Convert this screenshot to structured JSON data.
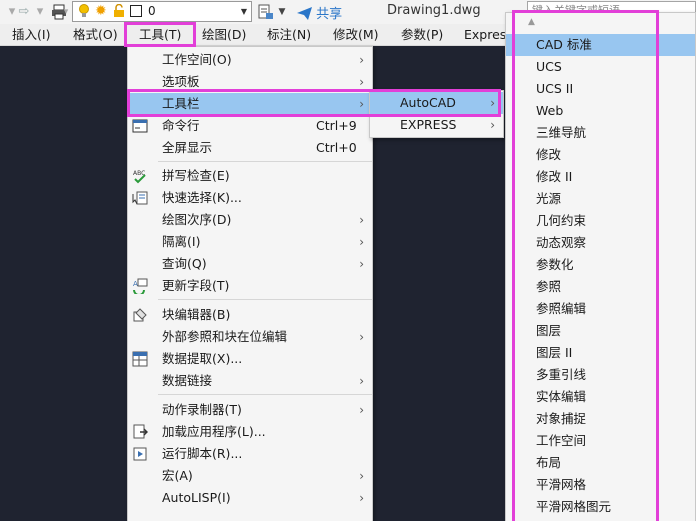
{
  "toolbar": {
    "layer_name": "0",
    "share_label": "共享",
    "document_title": "Drawing1.dwg",
    "search_placeholder": "键入关键字或短语"
  },
  "menubar": {
    "items": [
      "插入(I)",
      "格式(O)",
      "工具(T)",
      "绘图(D)",
      "标注(N)",
      "修改(M)",
      "参数(P)",
      "Expres"
    ],
    "active": "工具(T)"
  },
  "tools_menu": {
    "items": [
      {
        "label": "工作空间(O)",
        "shortcut": "",
        "submenu": true
      },
      {
        "label": "选项板",
        "shortcut": "",
        "submenu": true
      },
      {
        "label": "工具栏",
        "shortcut": "",
        "submenu": true,
        "highlighted": true
      },
      {
        "label": "命令行",
        "shortcut": "Ctrl+9",
        "submenu": false
      },
      {
        "label": "全屏显示",
        "shortcut": "Ctrl+0",
        "submenu": false
      },
      {
        "label": "拼写检查(E)",
        "shortcut": "",
        "submenu": false
      },
      {
        "label": "快速选择(K)...",
        "shortcut": "",
        "submenu": false
      },
      {
        "label": "绘图次序(D)",
        "shortcut": "",
        "submenu": true
      },
      {
        "label": "隔离(I)",
        "shortcut": "",
        "submenu": true
      },
      {
        "label": "查询(Q)",
        "shortcut": "",
        "submenu": true
      },
      {
        "label": "更新字段(T)",
        "shortcut": "",
        "submenu": false
      },
      {
        "label": "块编辑器(B)",
        "shortcut": "",
        "submenu": false
      },
      {
        "label": "外部参照和块在位编辑",
        "shortcut": "",
        "submenu": true
      },
      {
        "label": "数据提取(X)...",
        "shortcut": "",
        "submenu": false
      },
      {
        "label": "数据链接",
        "shortcut": "",
        "submenu": true
      },
      {
        "label": "动作录制器(T)",
        "shortcut": "",
        "submenu": true
      },
      {
        "label": "加载应用程序(L)...",
        "shortcut": "",
        "submenu": false
      },
      {
        "label": "运行脚本(R)...",
        "shortcut": "",
        "submenu": false
      },
      {
        "label": "宏(A)",
        "shortcut": "",
        "submenu": true
      },
      {
        "label": "AutoLISP(I)",
        "shortcut": "",
        "submenu": true
      }
    ]
  },
  "toolbar_submenu": {
    "items": [
      {
        "label": "AutoCAD",
        "highlighted": true
      },
      {
        "label": "EXPRESS",
        "highlighted": false
      }
    ]
  },
  "autocad_toolbars": {
    "items": [
      "CAD 标准",
      "UCS",
      "UCS II",
      "Web",
      "三维导航",
      "修改",
      "修改 II",
      "光源",
      "几何约束",
      "动态观察",
      "参数化",
      "参照",
      "参照编辑",
      "图层",
      "图层 II",
      "多重引线",
      "实体编辑",
      "对象捕捉",
      "工作空间",
      "布局",
      "平滑网格",
      "平滑网格图元"
    ],
    "highlighted": "CAD 标准"
  },
  "colors": {
    "highlight": "#98c6f0",
    "annotation_box": "#e23fd8",
    "canvas": "#1f2330"
  }
}
